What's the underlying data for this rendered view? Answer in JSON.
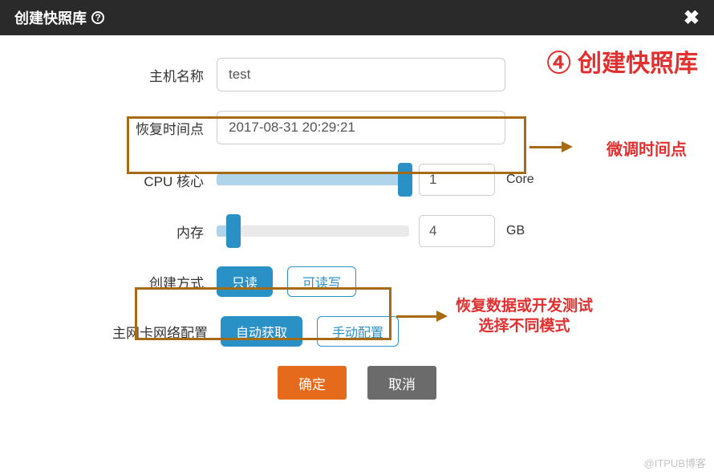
{
  "header": {
    "title": "创建快照库"
  },
  "form": {
    "hostname": {
      "label": "主机名称",
      "value": "test"
    },
    "restore_time": {
      "label": "恢复时间点",
      "value": "2017-08-31 20:29:21"
    },
    "cpu": {
      "label": "CPU 核心",
      "value": "1",
      "unit": "Core",
      "slider_pct": 100,
      "thumb_pct": 94
    },
    "memory": {
      "label": "内存",
      "value": "4",
      "unit": "GB",
      "slider_pct": 8,
      "thumb_pct": 5
    },
    "create_mode": {
      "label": "创建方式",
      "options": [
        {
          "label": "只读",
          "selected": true
        },
        {
          "label": "可读写",
          "selected": false
        }
      ]
    },
    "network": {
      "label": "主网卡网络配置",
      "options": [
        {
          "label": "自动获取",
          "selected": true
        },
        {
          "label": "手动配置",
          "selected": false
        }
      ]
    }
  },
  "actions": {
    "confirm": "确定",
    "cancel": "取消"
  },
  "annotations": {
    "step_title": "④ 创建快照库",
    "fine_tune_time": "微调时间点",
    "mode_hint_line1": "恢复数据或开发测试",
    "mode_hint_line2": "选择不同模式"
  },
  "watermark": "@ITPUB博客"
}
